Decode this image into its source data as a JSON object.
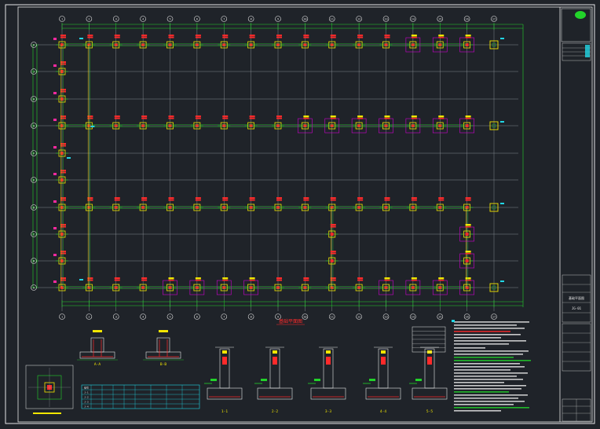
{
  "colors": {
    "background": "#1f2329",
    "frame": "#e6e6e6",
    "grid": "#9aa0a6",
    "dim": "#22d32a",
    "column": "#f2e600",
    "rebar": "#ff2a2a",
    "label_pink": "#ff2aa0",
    "label_cyan": "#21d7e6",
    "magenta": "#d000d0",
    "white": "#ffffff"
  },
  "grid_x": [
    "1",
    "2",
    "3",
    "4",
    "5",
    "6",
    "7",
    "8",
    "9",
    "10",
    "11",
    "12",
    "13",
    "14",
    "15",
    "16",
    "17"
  ],
  "grid_y": [
    "A",
    "B",
    "C",
    "D",
    "E",
    "F",
    "G",
    "H",
    "J",
    "K"
  ],
  "plan_title": "基础平面图",
  "footing_table": {
    "headers": [
      "编号",
      "截面尺寸",
      "底标高",
      "配筋",
      "备注",
      "",
      "",
      "",
      ""
    ],
    "rows": [
      [
        "J-1",
        "",
        "",
        "",
        "",
        "",
        "",
        "",
        ""
      ],
      [
        "J-2",
        "",
        "",
        "",
        "",
        "",
        "",
        "",
        ""
      ],
      [
        "J-3",
        "",
        "",
        "",
        "",
        "",
        "",
        "",
        ""
      ],
      [
        "J-4",
        "",
        "",
        "",
        "",
        "",
        "",
        "",
        ""
      ]
    ]
  },
  "sections": [
    "A-A",
    "B-B",
    "1-1",
    "2-2",
    "3-3",
    "4-4",
    "5-5"
  ],
  "title_block": {
    "project": "",
    "drawing_no": "JG-01",
    "drawing_name": "基础平面图"
  }
}
